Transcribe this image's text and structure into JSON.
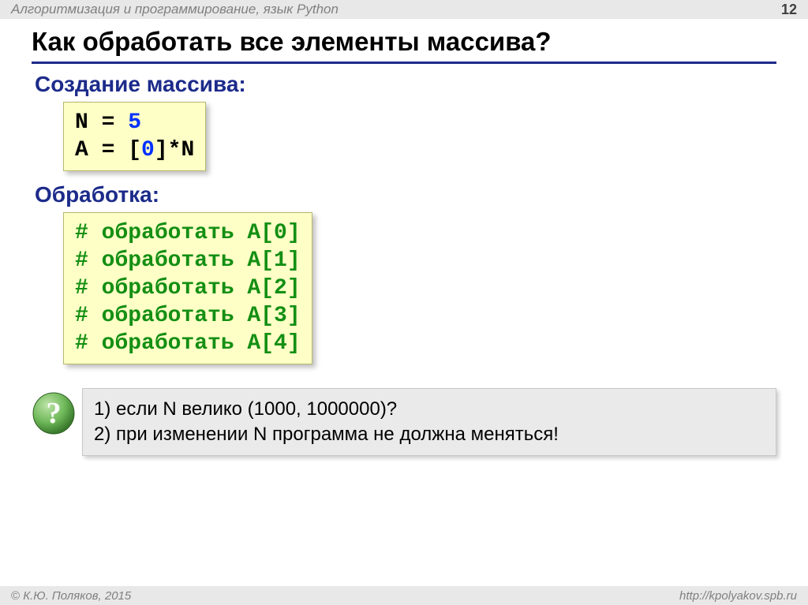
{
  "header": {
    "breadcrumb": "Алгоритмизация и программирование, язык Python",
    "page": "12"
  },
  "title": "Как обработать все элементы массива?",
  "section1": "Создание массива",
  "code1": {
    "l1_lhs": "N",
    "l1_eq": " = ",
    "l1_rhs": "5",
    "l2_lhs": "A",
    "l2_eq": " = [",
    "l2_zero": "0",
    "l2_tail": "]*N"
  },
  "section2": "Обработка",
  "code2": {
    "c0": "# обработать A[0]",
    "c1": "# обработать A[1]",
    "c2": "# обработать A[2]",
    "c3": "# обработать A[3]",
    "c4": "# обработать A[4]"
  },
  "question": {
    "q1": "1) если N велико (1000, 1000000)?",
    "q2": "2) при изменении N программа не должна меняться!"
  },
  "footer": {
    "copyright": " К.Ю. Поляков, 2015",
    "url": "http://kpolyakov.spb.ru"
  }
}
